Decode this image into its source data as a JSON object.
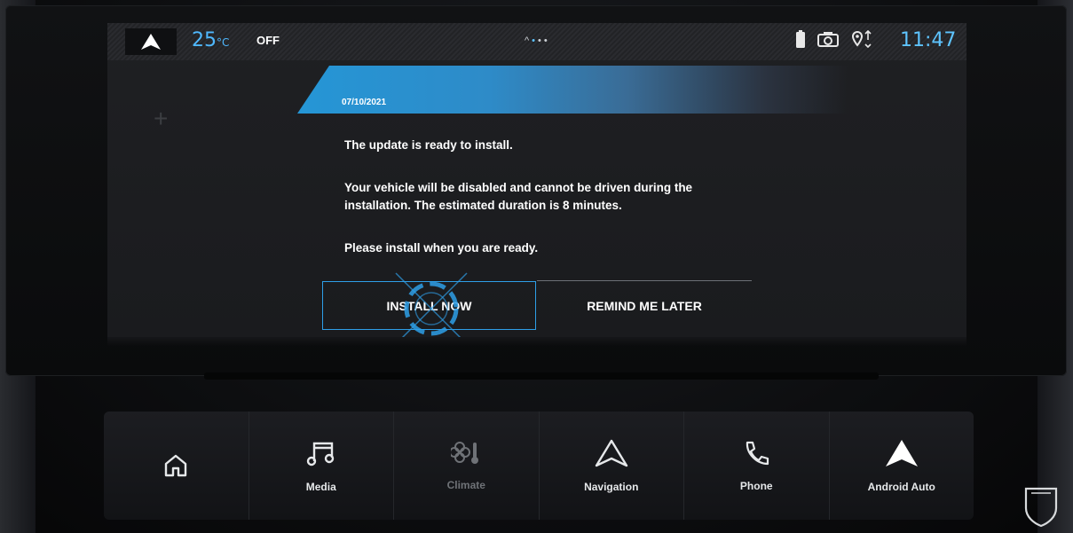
{
  "status_bar": {
    "temperature": "25",
    "temperature_unit": "°C",
    "ac_status": "OFF",
    "clock": "11:47",
    "icons": [
      "android-auto-icon",
      "battery-icon",
      "camera-icon",
      "location-icon"
    ]
  },
  "dialog": {
    "date": "07/10/2021",
    "line1": "The update is ready to install.",
    "line2": "Your vehicle will be disabled and cannot be driven during the installation. The estimated duration is 8 minutes.",
    "line3": "Please install when you are ready.",
    "install_button": "INSTALL NOW",
    "remind_button": "REMIND ME LATER"
  },
  "dock": {
    "items": [
      {
        "label": "",
        "icon": "home-icon"
      },
      {
        "label": "Media",
        "icon": "music-note-icon"
      },
      {
        "label": "Climate",
        "icon": "climate-fan-icon"
      },
      {
        "label": "Navigation",
        "icon": "navigation-arrow-icon"
      },
      {
        "label": "Phone",
        "icon": "phone-icon"
      },
      {
        "label": "Android Auto",
        "icon": "android-auto-icon"
      }
    ]
  },
  "colors": {
    "accent": "#5ec4ff",
    "button_border": "#2e9fe8",
    "header_band": "#2596d6"
  }
}
